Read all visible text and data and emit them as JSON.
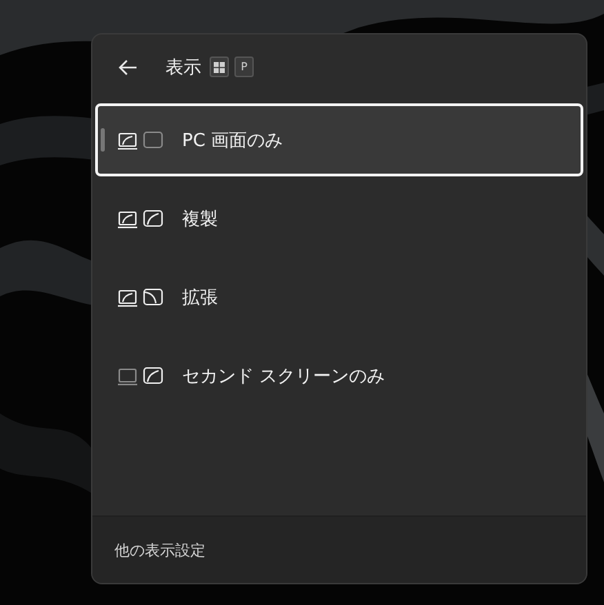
{
  "header": {
    "title": "表示",
    "shortcut_key": "P"
  },
  "options": [
    {
      "kind": "pc_only",
      "label": "PC 画面のみ",
      "selected": true
    },
    {
      "kind": "duplicate",
      "label": "複製",
      "selected": false
    },
    {
      "kind": "extend",
      "label": "拡張",
      "selected": false
    },
    {
      "kind": "second_only",
      "label": "セカンド スクリーンのみ",
      "selected": false
    }
  ],
  "footer": {
    "link": "他の表示設定"
  }
}
